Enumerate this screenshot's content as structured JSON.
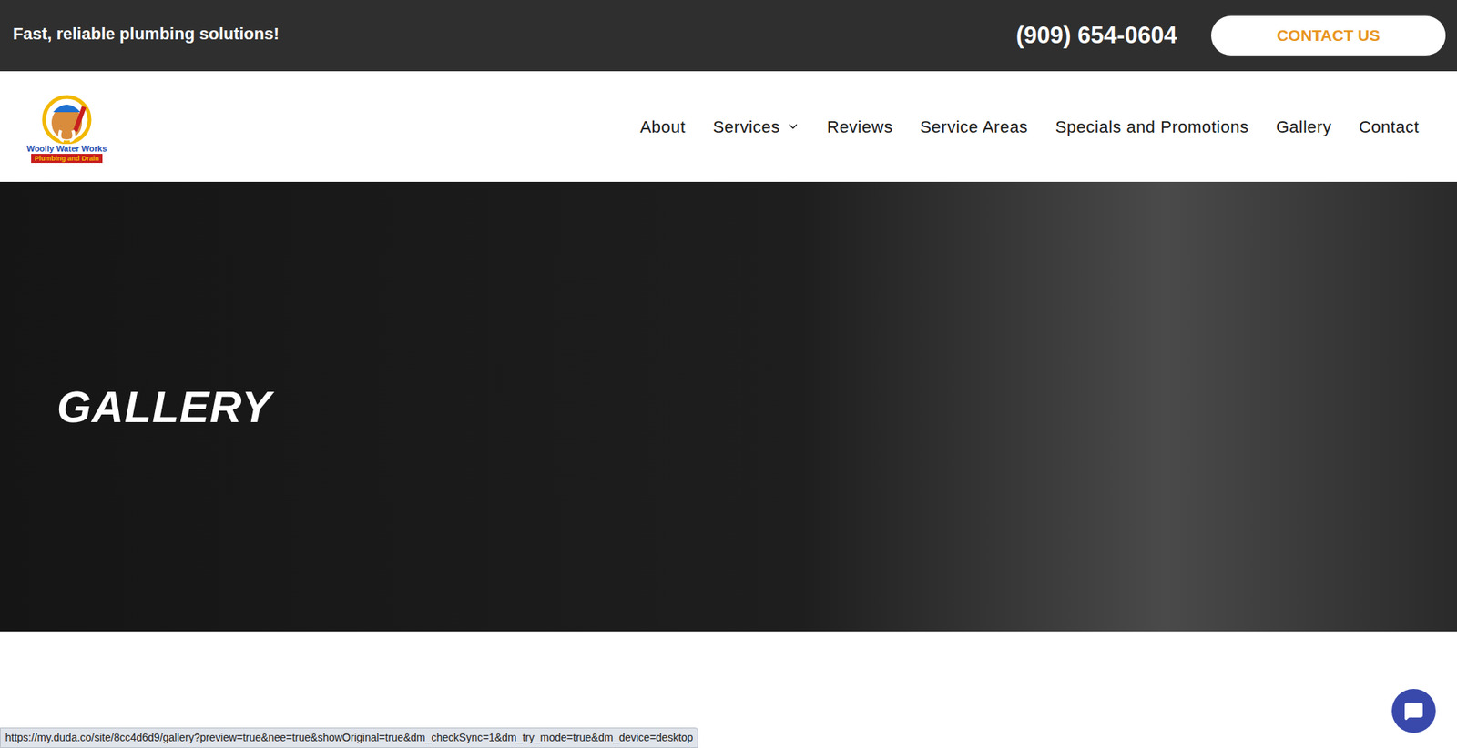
{
  "top_bar": {
    "tagline": "Fast, reliable plumbing solutions!",
    "phone": "(909) 654-0604",
    "cta": "CONTACT US"
  },
  "logo": {
    "name": "Woolly Water Works",
    "subtitle": "Plumbing and Drain"
  },
  "nav": {
    "items": [
      {
        "label": "About",
        "dropdown": false,
        "selected": false
      },
      {
        "label": "Services",
        "dropdown": true,
        "selected": false
      },
      {
        "label": "Reviews",
        "dropdown": false,
        "selected": false
      },
      {
        "label": "Service Areas",
        "dropdown": false,
        "selected": false
      },
      {
        "label": "Specials and Promotions",
        "dropdown": false,
        "selected": false
      },
      {
        "label": "Gallery",
        "dropdown": false,
        "selected": false
      },
      {
        "label": "Contact",
        "dropdown": false,
        "selected": false
      }
    ]
  },
  "hero": {
    "title": "GALLERY"
  },
  "status_bar": {
    "url": "https://my.duda.co/site/8cc4d6d9/gallery?preview=true&nee=true&showOriginal=true&dm_checkSync=1&dm_try_mode=true&dm_device=desktop"
  }
}
